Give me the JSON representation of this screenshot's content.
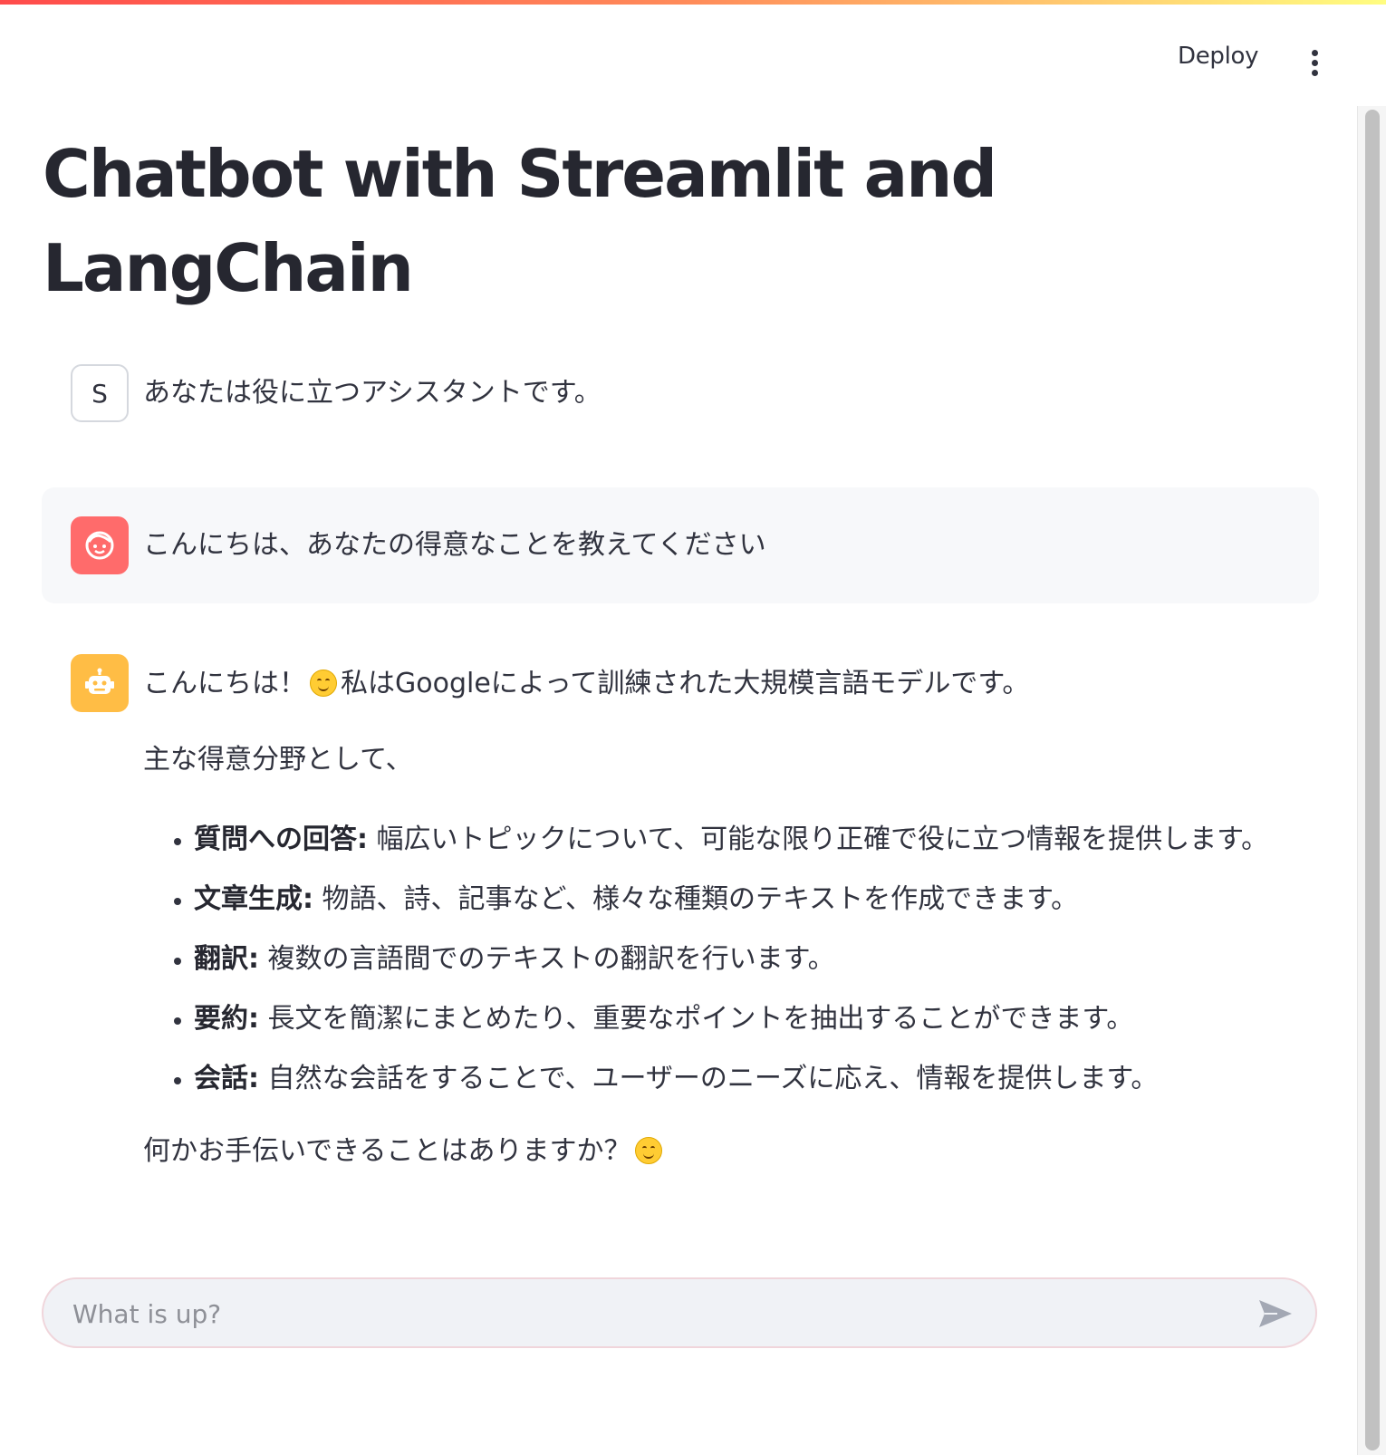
{
  "header": {
    "deploy_label": "Deploy",
    "menu_icon": "kebab-menu-icon"
  },
  "page": {
    "title": "Chatbot with Streamlit and LangChain"
  },
  "messages": [
    {
      "role": "system",
      "avatar_label": "S",
      "text": "あなたは役に立つアシスタントです。"
    },
    {
      "role": "user",
      "avatar_icon": "user-face-icon",
      "text": "こんにちは、あなたの得意なことを教えてください"
    },
    {
      "role": "assistant",
      "avatar_icon": "robot-icon",
      "intro_a": "こんにちは！",
      "intro_b": "私はGoogleによって訓練された大規模言語モデルです。",
      "lead": "主な得意分野として、",
      "items": [
        {
          "term": "質問への回答:",
          "desc": "幅広いトピックについて、可能な限り正確で役に立つ情報を提供します。"
        },
        {
          "term": "文章生成:",
          "desc": "物語、詩、記事など、様々な種類のテキストを作成できます。"
        },
        {
          "term": "翻訳:",
          "desc": "複数の言語間でのテキストの翻訳を行います。"
        },
        {
          "term": "要約:",
          "desc": "長文を簡潔にまとめたり、重要なポイントを抽出することができます。"
        },
        {
          "term": "会話:",
          "desc": "自然な会話をすることで、ユーザーのニーズに応え、情報を提供します。"
        }
      ],
      "closing": "何かお手伝いできることはありますか？",
      "emoji_icon": "smiling-face-emoji-icon"
    }
  ],
  "chat_input": {
    "placeholder": "What is up?",
    "value": "",
    "send_icon": "send-arrow-icon"
  },
  "colors": {
    "accent_gradient_start": "#ff4b4b",
    "accent_gradient_end": "#fffd80",
    "user_avatar": "#ff6b6b",
    "bot_avatar": "#ffbd45",
    "text": "#31333f"
  }
}
